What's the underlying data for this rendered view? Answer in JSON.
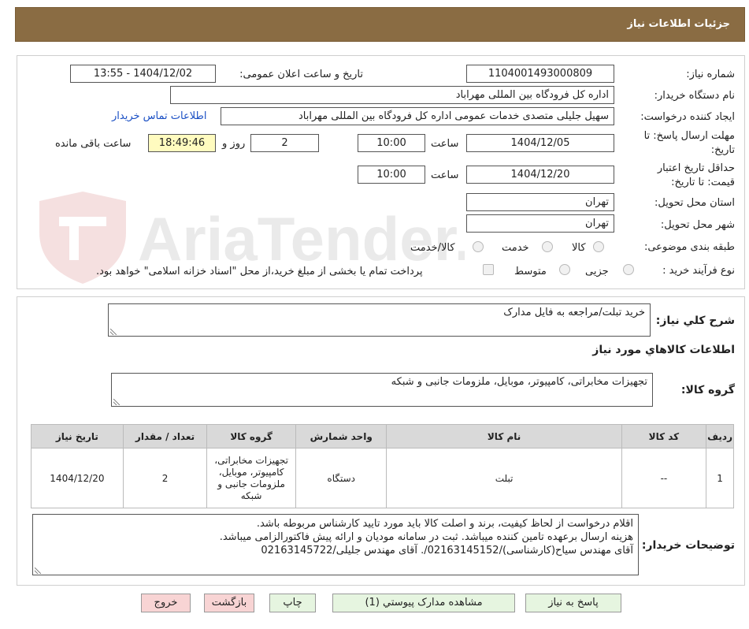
{
  "header": {
    "title": "جزئیات اطلاعات نیاز"
  },
  "watermark": {
    "text": "AriaTender.neT"
  },
  "form": {
    "need_number_label": "شماره نیاز:",
    "need_number_value": "1104001493000809",
    "announce_label": "تاریخ و ساعت اعلان عمومی:",
    "announce_value": "1404/12/02 - 13:55",
    "buyer_org_label": "نام دستگاه خریدار:",
    "buyer_org_value": "اداره کل فرودگاه بین المللی مهراباد",
    "requester_label": "ایجاد کننده درخواست:",
    "requester_value": "سهیل جلیلی متصدی خدمات عمومی اداره کل فرودگاه بین المللی مهراباد",
    "contact_link": "اطلاعات تماس خریدار",
    "deadline_label_line1": "مهلت ارسال پاسخ: تا",
    "deadline_label_line2": "تاریخ:",
    "deadline_date": "1404/12/05",
    "time_label": "ساعت",
    "deadline_time": "10:00",
    "days_value": "2",
    "days_label": "روز و",
    "remaining_time": "18:49:46",
    "remaining_label": "ساعت باقی مانده",
    "validity_label_line1": "حداقل تاریخ اعتبار",
    "validity_label_line2": "قیمت: تا تاریخ:",
    "validity_date": "1404/12/20",
    "validity_time_label": "ساعت",
    "validity_time": "10:00",
    "province_label": "استان محل تحویل:",
    "province_value": "تهران",
    "city_label": "شهر محل تحویل:",
    "city_value": "تهران",
    "category_label": "طبقه بندی موضوعی:",
    "category_options": [
      "کالا",
      "خدمت",
      "کالا/خدمت"
    ],
    "process_label": "نوع فرآیند خرید :",
    "process_options": [
      "جزیی",
      "متوسط"
    ],
    "payment_note": "پرداخت تمام یا بخشی از مبلغ خرید،از محل \"اسناد خزانه اسلامی\" خواهد بود."
  },
  "summary": {
    "label": "شرح کلي نياز:",
    "value": "خرید تبلت/مراجعه به فایل مدارک"
  },
  "goods_info": {
    "title": "اطلاعات کالاهاي مورد نياز",
    "group_label": "گروه کالا:",
    "group_value": "تجهیزات مخابراتی، کامپیوتر، موبایل، ملزومات جانبی و شبکه"
  },
  "table": {
    "headers": [
      "ردیف",
      "کد کالا",
      "نام کالا",
      "واحد شمارش",
      "گروه کالا",
      "تعداد / مقدار",
      "تاریخ نیاز"
    ],
    "rows": [
      [
        "1",
        "--",
        "تبلت",
        "دستگاه",
        "تجهیزات مخابراتی، کامپیوتر، موبایل، ملزومات جانبی و شبکه",
        "2",
        "1404/12/20"
      ]
    ]
  },
  "buyer_notes": {
    "label": "توضیحات خریدار:",
    "lines": [
      "اقلام درخواست از لحاظ کیفیت، برند و اصلت کالا باید مورد تایید کارشناس مربوطه باشد.",
      "هزینه ارسال برعهده تامین کننده میباشد. ثبت در سامانه مودیان و ارائه پیش فاکتورالزامی میباشد.",
      "آقای مهندس سیاح(کارشناسی)/02163145152/. آقای مهندس جلیلی/02163145722"
    ]
  },
  "buttons": {
    "reply": "پاسخ به نیاز",
    "attachments": "مشاهده مدارک پیوستي (1)",
    "print": "چاپ",
    "back": "بازگشت",
    "exit": "خروج"
  }
}
